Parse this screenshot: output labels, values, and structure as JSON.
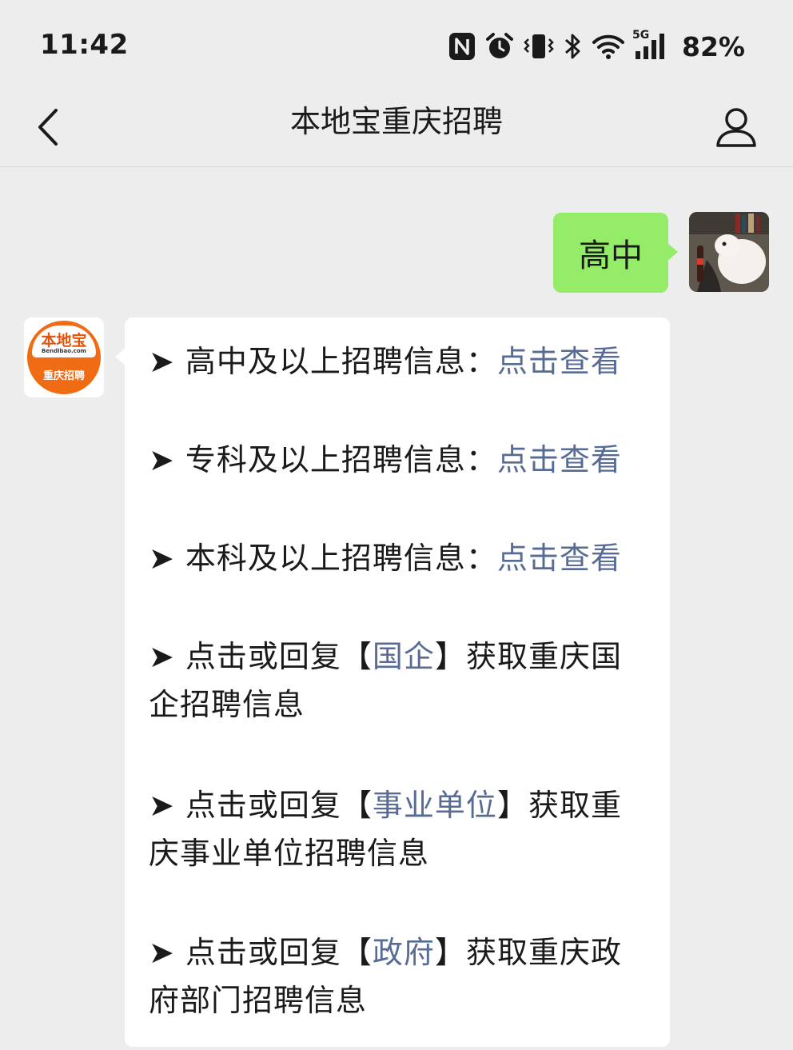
{
  "status_bar": {
    "time": "11:42",
    "network": "5G",
    "battery": "82%",
    "icons": [
      "nfc-icon",
      "alarm-icon",
      "vibrate-icon",
      "bluetooth-icon",
      "wifi-icon",
      "signal-icon"
    ]
  },
  "nav": {
    "title": "本地宝重庆招聘",
    "back_icon": "chevron-left-icon",
    "profile_icon": "person-icon"
  },
  "messages": {
    "outgoing": {
      "text": "高中"
    },
    "incoming": {
      "avatar": {
        "logo_name": "本地宝",
        "logo_domain": "Bendibao.com",
        "logo_sub": "重庆招聘"
      },
      "lines": [
        {
          "prefix": "➤ 高中及以上招聘信息：",
          "link": "点击查看"
        },
        {
          "prefix": "➤ 专科及以上招聘信息：",
          "link": "点击查看"
        },
        {
          "prefix": "➤ 本科及以上招聘信息：",
          "link": "点击查看"
        },
        {
          "prefix": "➤ 点击或回复【",
          "link": "国企",
          "suffix": "】获取重庆国企招聘信息"
        },
        {
          "prefix": "➤ 点击或回复【",
          "link": "事业单位",
          "suffix": "】获取重庆事业单位招聘信息"
        },
        {
          "prefix": "➤ 点击或回复【",
          "link": "政府",
          "suffix": "】获取重庆政府部门招聘信息"
        }
      ]
    }
  },
  "colors": {
    "background": "#ededed",
    "outgoing_bubble": "#95ec69",
    "link": "#576b95",
    "logo_orange": "#ef6c14"
  }
}
